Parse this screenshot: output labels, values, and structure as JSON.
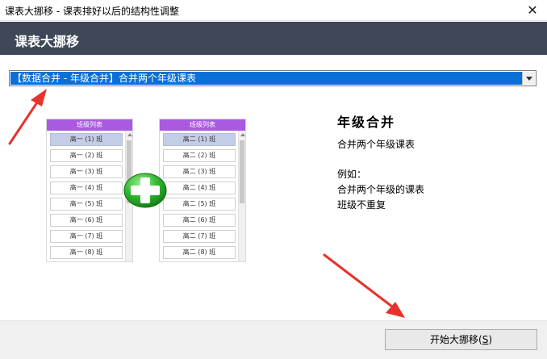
{
  "window": {
    "title": "课表大挪移 - 课表排好以后的结构性调整",
    "close_glyph": "✕"
  },
  "header": {
    "title": "课表大挪移"
  },
  "mode_select": {
    "value": "【数据合并 - 年级合并】合并两个年级课表"
  },
  "preview": {
    "left_panel": {
      "header": "班级列表",
      "items": [
        "高一 (1) 班",
        "高一 (2) 班",
        "高一 (3) 班",
        "高一 (4) 班",
        "高一 (5) 班",
        "高一 (6) 班",
        "高一 (7) 班",
        "高一 (8) 班"
      ]
    },
    "right_panel": {
      "header": "班级列表",
      "items": [
        "高二 (1) 班",
        "高二 (2) 班",
        "高二 (3) 班",
        "高二 (4) 班",
        "高二 (5) 班",
        "高二 (6) 班",
        "高二 (7) 班",
        "高二 (8) 班"
      ]
    },
    "plus_icon": "plus-circle-icon"
  },
  "info": {
    "title": "年级合并",
    "subtitle": "合并两个年级课表",
    "example_label": "例如：",
    "example_line1": "合并两个年级的课表",
    "example_line2": "班级不重复"
  },
  "footer": {
    "start_label": "开始大挪移(",
    "start_hotkey": "S",
    "start_suffix": ")"
  },
  "colors": {
    "header_bg": "#3f4857",
    "selection_blue": "#0a6fd6",
    "panel_header_purple": "#a95be0",
    "plus_green": "#2fb52f",
    "arrow_red": "#e8322c"
  }
}
